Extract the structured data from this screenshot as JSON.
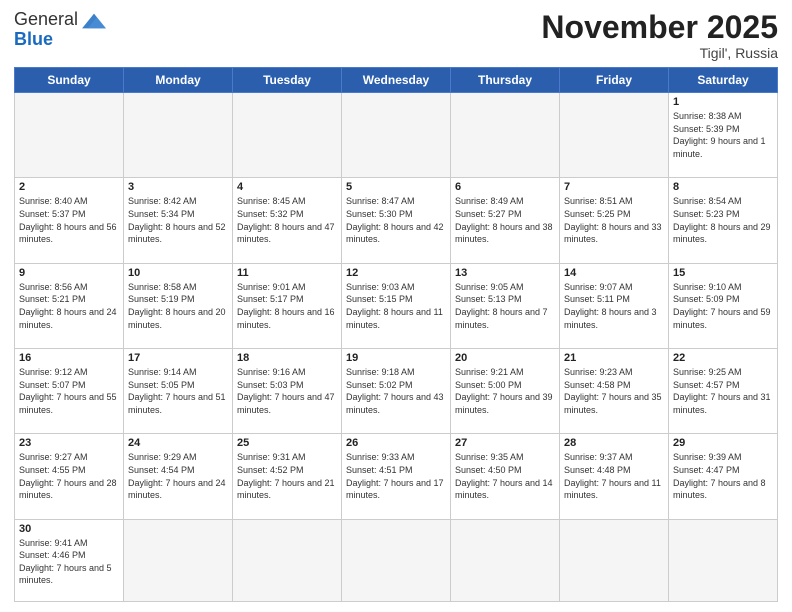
{
  "header": {
    "logo_general": "General",
    "logo_blue": "Blue",
    "month_title": "November 2025",
    "location": "Tigil', Russia"
  },
  "weekdays": [
    "Sunday",
    "Monday",
    "Tuesday",
    "Wednesday",
    "Thursday",
    "Friday",
    "Saturday"
  ],
  "days": {
    "1": {
      "sunrise": "Sunrise: 8:38 AM",
      "sunset": "Sunset: 5:39 PM",
      "daylight": "Daylight: 9 hours and 1 minute."
    },
    "2": {
      "sunrise": "Sunrise: 8:40 AM",
      "sunset": "Sunset: 5:37 PM",
      "daylight": "Daylight: 8 hours and 56 minutes."
    },
    "3": {
      "sunrise": "Sunrise: 8:42 AM",
      "sunset": "Sunset: 5:34 PM",
      "daylight": "Daylight: 8 hours and 52 minutes."
    },
    "4": {
      "sunrise": "Sunrise: 8:45 AM",
      "sunset": "Sunset: 5:32 PM",
      "daylight": "Daylight: 8 hours and 47 minutes."
    },
    "5": {
      "sunrise": "Sunrise: 8:47 AM",
      "sunset": "Sunset: 5:30 PM",
      "daylight": "Daylight: 8 hours and 42 minutes."
    },
    "6": {
      "sunrise": "Sunrise: 8:49 AM",
      "sunset": "Sunset: 5:27 PM",
      "daylight": "Daylight: 8 hours and 38 minutes."
    },
    "7": {
      "sunrise": "Sunrise: 8:51 AM",
      "sunset": "Sunset: 5:25 PM",
      "daylight": "Daylight: 8 hours and 33 minutes."
    },
    "8": {
      "sunrise": "Sunrise: 8:54 AM",
      "sunset": "Sunset: 5:23 PM",
      "daylight": "Daylight: 8 hours and 29 minutes."
    },
    "9": {
      "sunrise": "Sunrise: 8:56 AM",
      "sunset": "Sunset: 5:21 PM",
      "daylight": "Daylight: 8 hours and 24 minutes."
    },
    "10": {
      "sunrise": "Sunrise: 8:58 AM",
      "sunset": "Sunset: 5:19 PM",
      "daylight": "Daylight: 8 hours and 20 minutes."
    },
    "11": {
      "sunrise": "Sunrise: 9:01 AM",
      "sunset": "Sunset: 5:17 PM",
      "daylight": "Daylight: 8 hours and 16 minutes."
    },
    "12": {
      "sunrise": "Sunrise: 9:03 AM",
      "sunset": "Sunset: 5:15 PM",
      "daylight": "Daylight: 8 hours and 11 minutes."
    },
    "13": {
      "sunrise": "Sunrise: 9:05 AM",
      "sunset": "Sunset: 5:13 PM",
      "daylight": "Daylight: 8 hours and 7 minutes."
    },
    "14": {
      "sunrise": "Sunrise: 9:07 AM",
      "sunset": "Sunset: 5:11 PM",
      "daylight": "Daylight: 8 hours and 3 minutes."
    },
    "15": {
      "sunrise": "Sunrise: 9:10 AM",
      "sunset": "Sunset: 5:09 PM",
      "daylight": "Daylight: 7 hours and 59 minutes."
    },
    "16": {
      "sunrise": "Sunrise: 9:12 AM",
      "sunset": "Sunset: 5:07 PM",
      "daylight": "Daylight: 7 hours and 55 minutes."
    },
    "17": {
      "sunrise": "Sunrise: 9:14 AM",
      "sunset": "Sunset: 5:05 PM",
      "daylight": "Daylight: 7 hours and 51 minutes."
    },
    "18": {
      "sunrise": "Sunrise: 9:16 AM",
      "sunset": "Sunset: 5:03 PM",
      "daylight": "Daylight: 7 hours and 47 minutes."
    },
    "19": {
      "sunrise": "Sunrise: 9:18 AM",
      "sunset": "Sunset: 5:02 PM",
      "daylight": "Daylight: 7 hours and 43 minutes."
    },
    "20": {
      "sunrise": "Sunrise: 9:21 AM",
      "sunset": "Sunset: 5:00 PM",
      "daylight": "Daylight: 7 hours and 39 minutes."
    },
    "21": {
      "sunrise": "Sunrise: 9:23 AM",
      "sunset": "Sunset: 4:58 PM",
      "daylight": "Daylight: 7 hours and 35 minutes."
    },
    "22": {
      "sunrise": "Sunrise: 9:25 AM",
      "sunset": "Sunset: 4:57 PM",
      "daylight": "Daylight: 7 hours and 31 minutes."
    },
    "23": {
      "sunrise": "Sunrise: 9:27 AM",
      "sunset": "Sunset: 4:55 PM",
      "daylight": "Daylight: 7 hours and 28 minutes."
    },
    "24": {
      "sunrise": "Sunrise: 9:29 AM",
      "sunset": "Sunset: 4:54 PM",
      "daylight": "Daylight: 7 hours and 24 minutes."
    },
    "25": {
      "sunrise": "Sunrise: 9:31 AM",
      "sunset": "Sunset: 4:52 PM",
      "daylight": "Daylight: 7 hours and 21 minutes."
    },
    "26": {
      "sunrise": "Sunrise: 9:33 AM",
      "sunset": "Sunset: 4:51 PM",
      "daylight": "Daylight: 7 hours and 17 minutes."
    },
    "27": {
      "sunrise": "Sunrise: 9:35 AM",
      "sunset": "Sunset: 4:50 PM",
      "daylight": "Daylight: 7 hours and 14 minutes."
    },
    "28": {
      "sunrise": "Sunrise: 9:37 AM",
      "sunset": "Sunset: 4:48 PM",
      "daylight": "Daylight: 7 hours and 11 minutes."
    },
    "29": {
      "sunrise": "Sunrise: 9:39 AM",
      "sunset": "Sunset: 4:47 PM",
      "daylight": "Daylight: 7 hours and 8 minutes."
    },
    "30": {
      "sunrise": "Sunrise: 9:41 AM",
      "sunset": "Sunset: 4:46 PM",
      "daylight": "Daylight: 7 hours and 5 minutes."
    }
  }
}
